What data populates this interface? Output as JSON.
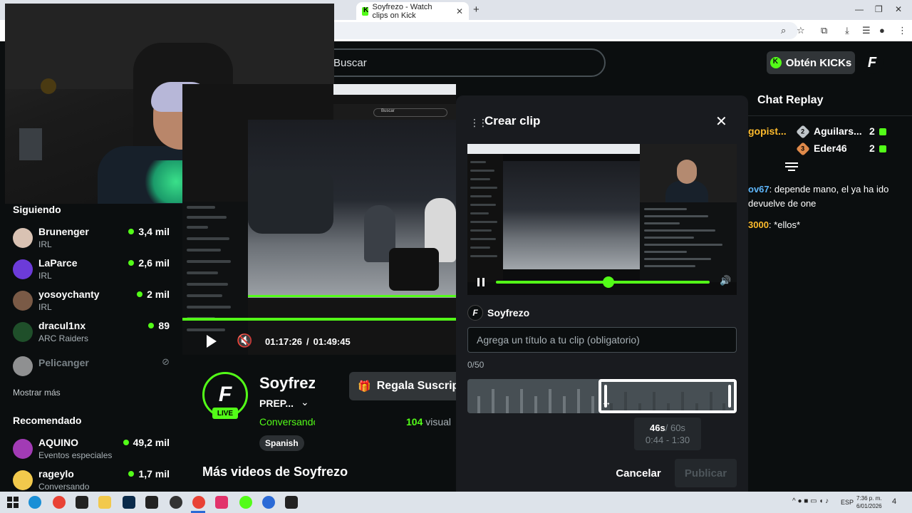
{
  "browser": {
    "tabs": [
      {
        "title": ""
      },
      {
        "title": "Soyfrezo - Watch clips on Kick"
      }
    ],
    "new_tab": "+"
  },
  "header": {
    "search_placeholder": "Buscar",
    "kicks_button": "Obtén KICKs"
  },
  "sidebar": {
    "following_heading": "Siguiendo",
    "following": [
      {
        "name": "Brunenger",
        "category": "IRL",
        "viewers": "3,4 mil",
        "avatar_color": "#d9c2b3"
      },
      {
        "name": "LaParce",
        "category": "IRL",
        "viewers": "2,6 mil",
        "avatar_color": "#6c3bd9"
      },
      {
        "name": "yosoychanty",
        "category": "IRL",
        "viewers": "2 mil",
        "avatar_color": "#7a5a46"
      },
      {
        "name": "dracul1nx",
        "category": "ARC Raiders",
        "viewers": "89",
        "avatar_color": "#1f4f2a"
      },
      {
        "name": "Pelicanger",
        "category": "",
        "viewers": "",
        "avatar_color": "#e8e8e8",
        "offline": true
      }
    ],
    "show_more": "Mostrar más",
    "recommended_heading": "Recomendado",
    "recommended": [
      {
        "name": "AQUINO",
        "category": "Eventos especiales",
        "viewers": "49,2 mil",
        "avatar_color": "#a23bb5"
      },
      {
        "name": "rageylo",
        "category": "Conversando",
        "viewers": "1,7 mil",
        "avatar_color": "#f2c94c"
      }
    ]
  },
  "player": {
    "current_time": "01:17:26",
    "separator": "/",
    "total_time": "01:49:45",
    "nested_search": "Buscar"
  },
  "channel": {
    "name": "Soyfrezo",
    "stream_title": "PREP...",
    "category": "Conversando",
    "live_label": "LIVE",
    "language": "Spanish",
    "gift_button": "Regala Suscrip",
    "viewers_count": "104",
    "viewers_label": "visual",
    "more_videos": "Más videos de Soyfrezo"
  },
  "chat": {
    "title": "Chat Replay",
    "gifters": [
      {
        "left": "gopist...",
        "rank": "2",
        "user": "Aguilars...",
        "count": "2",
        "badge_color": "#c0c6ca"
      },
      {
        "left": "",
        "rank": "3",
        "user": "Eder46",
        "count": "2",
        "badge_color": "#e08a4a"
      }
    ],
    "messages": [
      {
        "user": "ov67",
        "sep": ":",
        "text": " depende mano, el ya ha ido devuelve de one",
        "user_color": "blue"
      },
      {
        "user": "3000",
        "sep": ":",
        "text": " *ellos*",
        "user_color": "gold"
      }
    ]
  },
  "modal": {
    "title": "Crear clip",
    "streamer": "Soyfrezo",
    "title_placeholder": "Agrega un título a tu clip (obligatorio)",
    "char_count": "0/50",
    "duration": "46s",
    "max_duration": "/ 60s",
    "range": "0:44 - 1:30",
    "cancel": "Cancelar",
    "publish": "Publicar"
  },
  "taskbar": {
    "language": "ESP",
    "time": "7:36 p. m.",
    "date": "6/01/2026",
    "notifications": "4"
  }
}
